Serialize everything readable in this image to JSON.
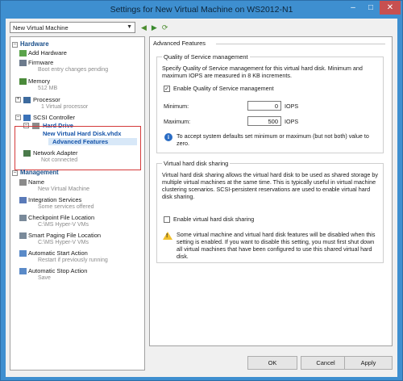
{
  "window": {
    "title": "Settings for New Virtual Machine on WS2012-N1"
  },
  "vm_selector": {
    "value": "New Virtual Machine"
  },
  "hardware": {
    "header": "Hardware",
    "add_hardware": "Add Hardware",
    "firmware": {
      "label": "Firmware",
      "sub": "Boot entry changes pending"
    },
    "memory": {
      "label": "Memory",
      "sub": "512 MB"
    },
    "processor": {
      "label": "Processor",
      "sub": "1 Virtual processor"
    },
    "scsi": {
      "label": "SCSI Controller"
    },
    "hard_drive": {
      "label": "Hard Drive",
      "sub": "New Virtual Hard Disk.vhdx"
    },
    "advanced_features": "Advanced Features",
    "network_adapter": {
      "label": "Network Adapter",
      "sub": "Not connected"
    }
  },
  "management": {
    "header": "Management",
    "items": [
      {
        "label": "Name",
        "sub": "New Virtual Machine"
      },
      {
        "label": "Integration Services",
        "sub": "Some services offered"
      },
      {
        "label": "Checkpoint File Location",
        "sub": "C:\\MS Hyper-V VMs"
      },
      {
        "label": "Smart Paging File Location",
        "sub": "C:\\MS Hyper-V VMs"
      },
      {
        "label": "Automatic Start Action",
        "sub": "Restart if previously running"
      },
      {
        "label": "Automatic Stop Action",
        "sub": "Save"
      }
    ]
  },
  "advanced": {
    "title": "Advanced Features",
    "qos": {
      "group_label": "Quality of Service management",
      "description": "Specify Quality of Service management for this virtual hard disk. Minimum and maximum IOPS are measured in 8 KB increments.",
      "enable_label": "Enable Quality of Service management",
      "enabled": true,
      "minimum_label": "Minimum:",
      "minimum_value": "0",
      "maximum_label": "Maximum:",
      "maximum_value": "500",
      "unit": "IOPS",
      "info_text": "To accept system defaults set minimum or maximum (but not both) value to zero."
    },
    "sharing": {
      "group_label": "Virtual hard disk sharing",
      "description": "Virtual hard disk sharing allows the virtual hard disk to be used as shared storage by multiple virtual machines at the same time. This is typically useful in virtual machine clustering scenarios. SCSI-persistent reservations are used to enable virtual hard disk sharing.",
      "enable_label": "Enable virtual hard disk sharing",
      "enabled": false,
      "warning_text": "Some virtual machine and virtual hard disk features will be disabled when this setting is enabled. If you want to disable this setting, you must first shut down all virtual machines that have been configured to use this shared virtual hard disk."
    }
  },
  "buttons": {
    "ok": "OK",
    "cancel": "Cancel",
    "apply": "Apply"
  }
}
